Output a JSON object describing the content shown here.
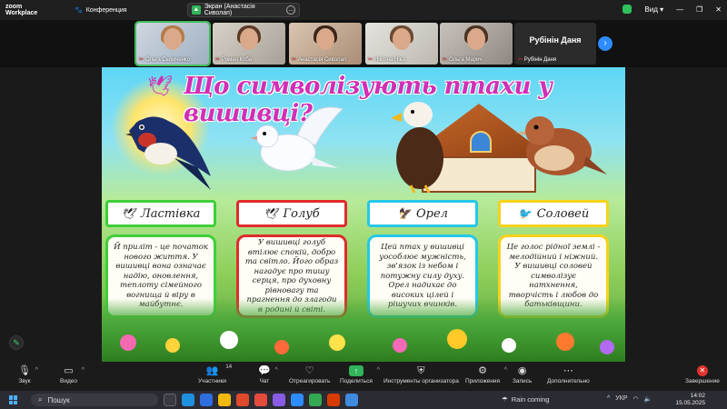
{
  "topbar": {
    "app_line1": "zoom",
    "app_line2": "Workplace",
    "conference_label": "Конференция",
    "share_label": "Экран (Анастасія Сиволап)",
    "view_label": "Вид"
  },
  "participants": [
    {
      "name": "Ольга Сьомченко",
      "active": true
    },
    {
      "name": "Роман Коба",
      "active": false
    },
    {
      "name": "Анастасія Сиволап",
      "active": false
    },
    {
      "name": "Нікітіна Ніка",
      "active": false
    },
    {
      "name": "Ольга Марич",
      "active": false
    },
    {
      "name": "Рубінін Даня",
      "active": false
    }
  ],
  "slide": {
    "title": "Що символізують птахи у вишивці?",
    "cards": [
      {
        "name": "Ластівка",
        "text": "Й приліт - це початок нового життя. У вишивці вона означає надію, оновлення, теплоту сімейного вогнища й віру в майбутнє."
      },
      {
        "name": "Голуб",
        "text": "У вишивці голуб втілює спокій, добро та світло. Його образ нагадує про тишу серця, про духовну рівновагу та прагнення до злагоди в родині й світі."
      },
      {
        "name": "Орел",
        "text": "Цей птах у вишивці уособлює мужність, зв'язок із небом і потужну силу духу. Орел надихає до високих цілей і рішучих вчинків."
      },
      {
        "name": "Соловей",
        "text": "Це голос рідної землі - мелодійний і ніжний. У вишивці соловей символізує натхнення, творчість і любов до батьківщини."
      }
    ]
  },
  "toolbar": {
    "audio": "Звук",
    "video": "Видео",
    "participants": "Участники",
    "participants_count": "14",
    "chat": "Чат",
    "react": "Отреагировать",
    "share": "Поделиться",
    "host_tools": "Инструменты организатора",
    "apps": "Приложения",
    "record": "Запись",
    "more": "Дополнительно",
    "end": "Завершение"
  },
  "taskbar": {
    "search_placeholder": "Пошук",
    "weather": "Rain coming",
    "lang": "УКР",
    "time": "14:02",
    "date": "15.05.2025"
  },
  "colors": {
    "accent_green": "#31b45b",
    "title_pink": "#d12fb5",
    "card_green": "#3fcf3a",
    "card_red": "#e02b2b",
    "card_cyan": "#25c8e8",
    "card_yellow": "#f6d21b"
  }
}
